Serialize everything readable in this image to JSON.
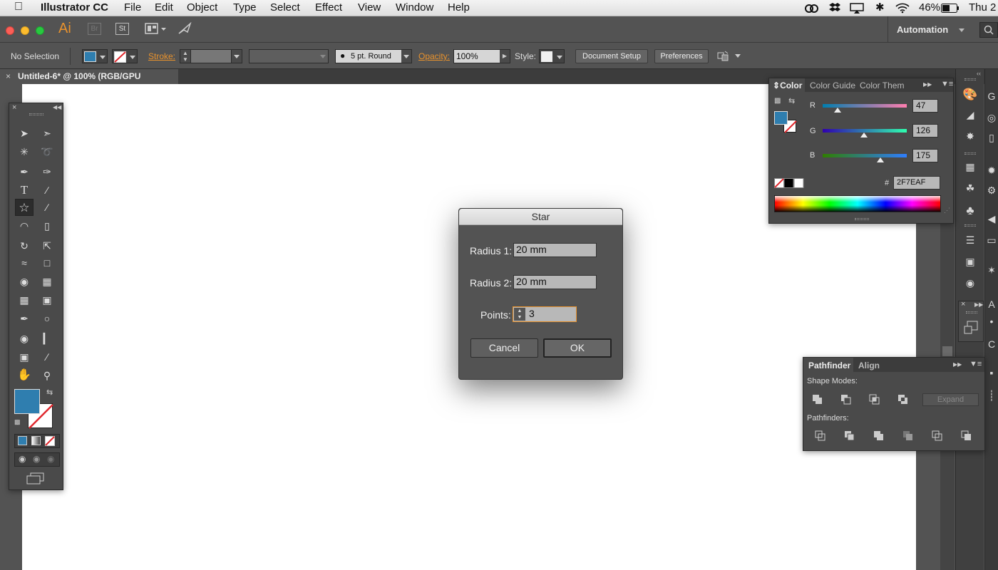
{
  "menubar": {
    "app_name": "Illustrator CC",
    "items": [
      "File",
      "Edit",
      "Object",
      "Type",
      "Select",
      "Effect",
      "View",
      "Window",
      "Help"
    ],
    "battery": "46%",
    "clock": "Thu 2"
  },
  "appbar": {
    "app_logo": "Ai",
    "bridge": "Br",
    "stock": "St",
    "workspace": "Automation"
  },
  "control_bar": {
    "selection": "No Selection",
    "fill_color": "#2f7eaf",
    "stroke_label": "Stroke:",
    "brush": "5 pt. Round",
    "opacity_label": "Opacity:",
    "opacity_value": "100%",
    "style_label": "Style:",
    "document_setup": "Document Setup",
    "preferences": "Preferences"
  },
  "document_tab": {
    "title": "Untitled-6* @ 100% (RGB/GPU Preview)"
  },
  "color_panel": {
    "tabs": [
      "Color",
      "Color Guide",
      "Color Them"
    ],
    "channels": [
      {
        "label": "R",
        "value": "47",
        "fraction": 0.18
      },
      {
        "label": "G",
        "value": "126",
        "fraction": 0.49
      },
      {
        "label": "B",
        "value": "175",
        "fraction": 0.69
      }
    ],
    "hex_label": "#",
    "hex": "2F7EAF"
  },
  "pathfinder_panel": {
    "tabs": [
      "Pathfinder",
      "Align"
    ],
    "shape_modes_label": "Shape Modes:",
    "expand_label": "Expand",
    "pathfinders_label": "Pathfinders:"
  },
  "star_dialog": {
    "title": "Star",
    "radius1_label": "Radius 1:",
    "radius1_value": "20 mm",
    "radius2_label": "Radius 2:",
    "radius2_value": "20 mm",
    "points_label": "Points:",
    "points_value": "3",
    "cancel_label": "Cancel",
    "ok_label": "OK"
  },
  "colors": {
    "accent_orange": "#e8922d",
    "fill_blue": "#2f7eaf",
    "stroke_none_red": "#e0282d"
  }
}
